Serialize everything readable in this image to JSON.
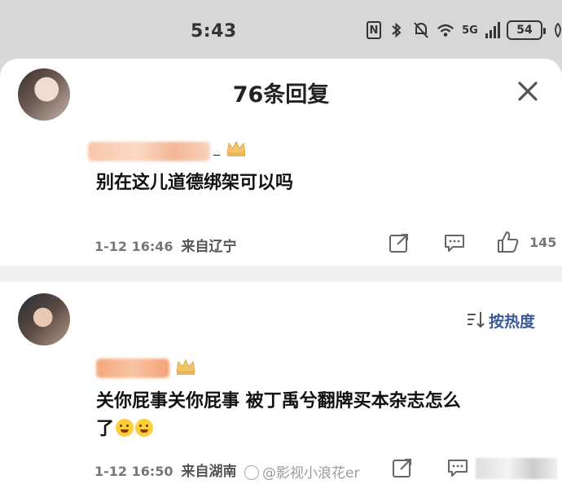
{
  "status_bar": {
    "time": "5:43",
    "nfc": "N",
    "network": "5G",
    "battery": "54"
  },
  "sheet": {
    "title": "76条回复",
    "icons": {
      "left": "refresh-icon",
      "right": "close-icon"
    }
  },
  "comments": [
    {
      "name_suffix": "_",
      "text": "别在这儿道德绑架可以吗",
      "date": "1-12 16:46",
      "location": "来自辽宁",
      "likes": "145"
    },
    {
      "text_line1": "关你屁事关你屁事 被丁禹兮翻牌买本杂志怎么",
      "text_line2": "了",
      "date": "1-12 16:50",
      "location": "来自湖南"
    }
  ],
  "sort": {
    "label": "按热度"
  },
  "watermark": "@影视小浪花er",
  "colors": {
    "accent": "#3a5a9a",
    "background": "#ffffff",
    "status_bar": "#d7d7d7"
  }
}
